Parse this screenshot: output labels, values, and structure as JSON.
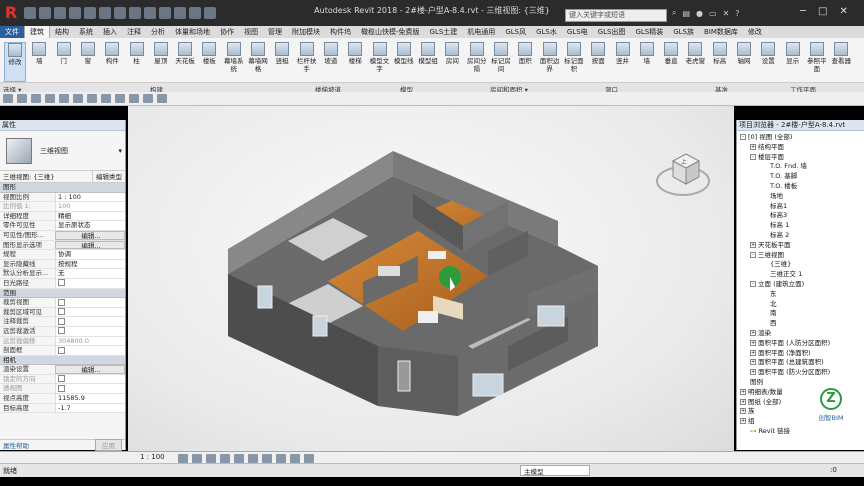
{
  "title": {
    "text": "Autodesk Revit 2018 -    2#楼-户型A-8.4.rvt - 三维视图: {三维}",
    "app_letter": "R",
    "search_placeholder": "键入关键字或短语"
  },
  "tabs": [
    "文件",
    "建筑",
    "结构",
    "系统",
    "插入",
    "注释",
    "分析",
    "体量和场地",
    "协作",
    "视图",
    "管理",
    "附加模块",
    "构件坞",
    "橄榄山快模-免费版",
    "GLS土建",
    "机电通用",
    "GLS风",
    "GLS水",
    "GLS电",
    "GLS出图",
    "GLS精装",
    "GLS族",
    "BIM数据库",
    "修改"
  ],
  "ribbon": {
    "buttons": [
      "修改",
      "墙",
      "门",
      "窗",
      "构件",
      "柱",
      "屋顶",
      "天花板",
      "楼板",
      "幕墙系统",
      "幕墙网格",
      "竖梃",
      "栏杆扶手",
      "坡道",
      "楼梯",
      "模型文字",
      "模型线",
      "模型组",
      "房间",
      "房间分隔",
      "标记房间",
      "面积",
      "面积边界",
      "标记面积",
      "按面",
      "竖井",
      "墙",
      "垂直",
      "老虎窗",
      "标高",
      "轴网",
      "设置",
      "显示",
      "参照平面",
      "查看器"
    ],
    "panels": [
      "选择 ▾",
      "构建",
      "楼梯坡道",
      "模型",
      "房间和面积 ▾",
      "洞口",
      "基准",
      "工作平面"
    ]
  },
  "properties": {
    "header": "属性",
    "type_name": "三维视图",
    "selector": "三维视图: {三维}",
    "edit_type": "编辑类型",
    "sections": [
      {
        "name": "图形",
        "rows": [
          {
            "k": "视图比例",
            "v": "1 : 100"
          },
          {
            "k": "比例值 1:",
            "v": "100",
            "grey": true
          },
          {
            "k": "详细程度",
            "v": "精细"
          },
          {
            "k": "零件可见性",
            "v": "显示原状态"
          },
          {
            "k": "可见性/图形...",
            "v": "编辑...",
            "btn": true
          },
          {
            "k": "图形显示选项",
            "v": "编辑...",
            "btn": true
          },
          {
            "k": "规程",
            "v": "协调"
          },
          {
            "k": "显示隐藏线",
            "v": "按规程"
          },
          {
            "k": "默认分析显示...",
            "v": "无"
          },
          {
            "k": "日光路径",
            "cb": true
          }
        ]
      },
      {
        "name": "范围",
        "rows": [
          {
            "k": "裁剪视图",
            "cb": true
          },
          {
            "k": "裁剪区域可见",
            "cb": true
          },
          {
            "k": "注释裁剪",
            "cb": true
          },
          {
            "k": "远剪裁激活",
            "cb": true
          },
          {
            "k": "远剪裁偏移",
            "v": "304800.0",
            "grey": true
          },
          {
            "k": "剖面框",
            "cb": true
          }
        ]
      },
      {
        "name": "相机",
        "rows": [
          {
            "k": "渲染设置",
            "v": "编辑...",
            "btn": true
          },
          {
            "k": "锁定的方向",
            "cb": true,
            "grey": true
          },
          {
            "k": "透视图",
            "cb": true,
            "grey": true
          },
          {
            "k": "视点高度",
            "v": "11585.9"
          },
          {
            "k": "目标高度",
            "v": "-1.7"
          }
        ]
      }
    ],
    "help": "属性帮助",
    "apply": "应用"
  },
  "browser": {
    "header": "项目浏览器 - 2#楼-户型A-8.4.rvt",
    "nodes": [
      {
        "d": 0,
        "t": "[0] 视图 (全部)",
        "tog": "-"
      },
      {
        "d": 1,
        "t": "结构平面",
        "tog": "+"
      },
      {
        "d": 1,
        "t": "楼层平面",
        "tog": "-"
      },
      {
        "d": 2,
        "t": "T.O. Fnd. 墙"
      },
      {
        "d": 2,
        "t": "T.O. 基脚"
      },
      {
        "d": 2,
        "t": "T.O. 楼板"
      },
      {
        "d": 2,
        "t": "场地"
      },
      {
        "d": 2,
        "t": "标高1"
      },
      {
        "d": 2,
        "t": "标高3"
      },
      {
        "d": 2,
        "t": "标高 1"
      },
      {
        "d": 2,
        "t": "标高 2"
      },
      {
        "d": 1,
        "t": "天花板平面",
        "tog": "+"
      },
      {
        "d": 1,
        "t": "三维视图",
        "tog": "-"
      },
      {
        "d": 2,
        "t": "{三维}"
      },
      {
        "d": 2,
        "t": "三维正交 1"
      },
      {
        "d": 1,
        "t": "立面 (建筑立面)",
        "tog": "-"
      },
      {
        "d": 2,
        "t": "东"
      },
      {
        "d": 2,
        "t": "北"
      },
      {
        "d": 2,
        "t": "南"
      },
      {
        "d": 2,
        "t": "西"
      },
      {
        "d": 1,
        "t": "渲染",
        "tog": "+"
      },
      {
        "d": 1,
        "t": "面积平面 (人防分区面积)",
        "tog": "+"
      },
      {
        "d": 1,
        "t": "面积平面 (净面积)",
        "tog": "+"
      },
      {
        "d": 1,
        "t": "面积平面 (总建筑面积)",
        "tog": "+"
      },
      {
        "d": 1,
        "t": "面积平面 (防火分区面积)",
        "tog": "+"
      },
      {
        "d": 0,
        "t": "图例"
      },
      {
        "d": 0,
        "t": "明细表/数量",
        "tog": "+"
      },
      {
        "d": 0,
        "t": "图纸 (全部)",
        "tog": "+"
      },
      {
        "d": 0,
        "t": "族",
        "tog": "+"
      },
      {
        "d": 0,
        "t": "组",
        "tog": "+"
      },
      {
        "d": 0,
        "t": "Revit 链接",
        "link": true
      }
    ]
  },
  "viewport": {
    "scale": "1 : 100",
    "watermark": "创智BIM",
    "viewcube_label": "上"
  },
  "status": {
    "text": "就绪",
    "workset": "主模型",
    "counter": ":0"
  },
  "colors": {
    "title_bg": "#2b2b2b",
    "file_tab": "#2a5fa0",
    "floor": "#c8782a",
    "wall": "#5a5a5a",
    "logo": "#2d9a3e"
  }
}
